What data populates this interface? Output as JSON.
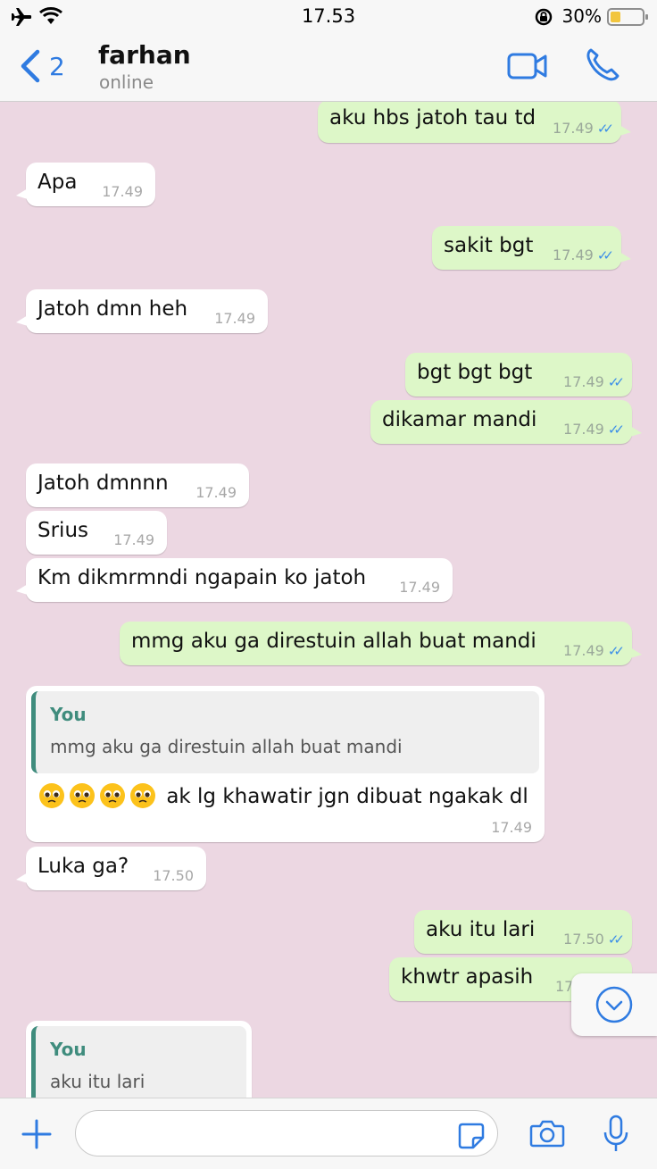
{
  "status_bar": {
    "time": "17.53",
    "battery_percent": "30%"
  },
  "header": {
    "back_count": "2",
    "contact_name": "farhan",
    "contact_status": "online"
  },
  "messages": [
    {
      "text": "aku hbs jatoh tau td",
      "time": "17.49"
    },
    {
      "text": "Apa",
      "time": "17.49"
    },
    {
      "text": "sakit bgt",
      "time": "17.49"
    },
    {
      "text": "Jatoh dmn heh",
      "time": "17.49"
    },
    {
      "text": "bgt bgt bgt",
      "time": "17.49"
    },
    {
      "text": "dikamar mandi",
      "time": "17.49"
    },
    {
      "text": "Jatoh dmnnn",
      "time": "17.49"
    },
    {
      "text": "Srius",
      "time": "17.49"
    },
    {
      "text": "Km dikmrmndi ngapain ko jatoh",
      "time": "17.49"
    },
    {
      "text": "mmg aku ga direstuin allah buat mandi",
      "time": "17.49"
    },
    {
      "quote_author": "You",
      "quote_text": "mmg aku ga direstuin allah buat mandi",
      "emoji": "🥺🥺🥺🥺",
      "text": "ak lg khawatir jgn dibuat ngakak dl",
      "time": "17.49"
    },
    {
      "text": "Luka ga?",
      "time": "17.50"
    },
    {
      "text": "aku itu lari",
      "time": "17.50"
    },
    {
      "text": "khwtr apasih",
      "time": "17"
    },
    {
      "quote_author": "You",
      "quote_text": "aku itu lari"
    }
  ],
  "input": {
    "placeholder": ""
  },
  "colors": {
    "accent": "#2f7be1",
    "incoming_bubble": "#ffffff",
    "outgoing_bubble": "#ddf7c8",
    "chat_background": "#ecd7e2",
    "quote_bar": "#3f8c7d",
    "read_ticks": "#3c8ee8"
  }
}
